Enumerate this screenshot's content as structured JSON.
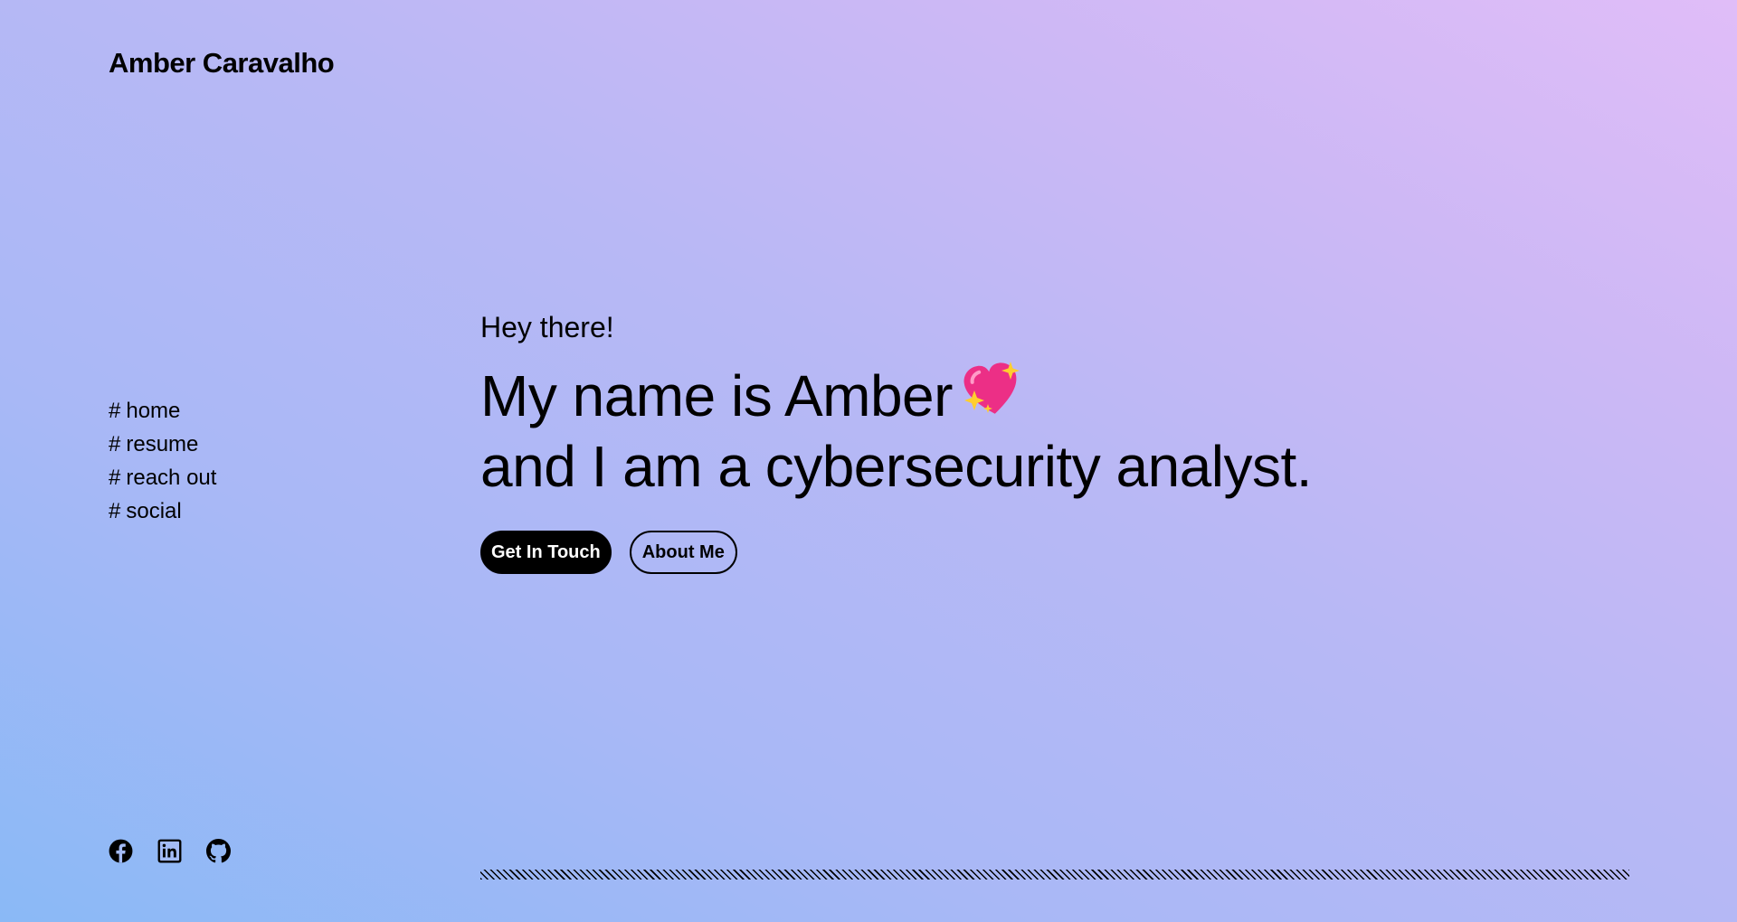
{
  "site": {
    "brand": "Amber Caravalho"
  },
  "nav": {
    "hash": "#",
    "items": [
      {
        "label": "home"
      },
      {
        "label": "resume"
      },
      {
        "label": "reach out"
      },
      {
        "label": "social"
      }
    ]
  },
  "hero": {
    "greeting": "Hey there!",
    "headline_line1": "My name is Amber",
    "headline_line2": "and I am a cybersecurity analyst.",
    "primary_button": "Get In Touch",
    "secondary_button": "About Me"
  },
  "social": {
    "icons": [
      "facebook-icon",
      "linkedin-icon",
      "github-icon"
    ]
  },
  "colors": {
    "gradient_start": "#8ab9f6",
    "gradient_end": "#e0bdf8",
    "heart": "#ec2f86",
    "sparkle": "#ffce2e",
    "button_primary_bg": "#000000",
    "button_primary_text": "#ffffff"
  }
}
